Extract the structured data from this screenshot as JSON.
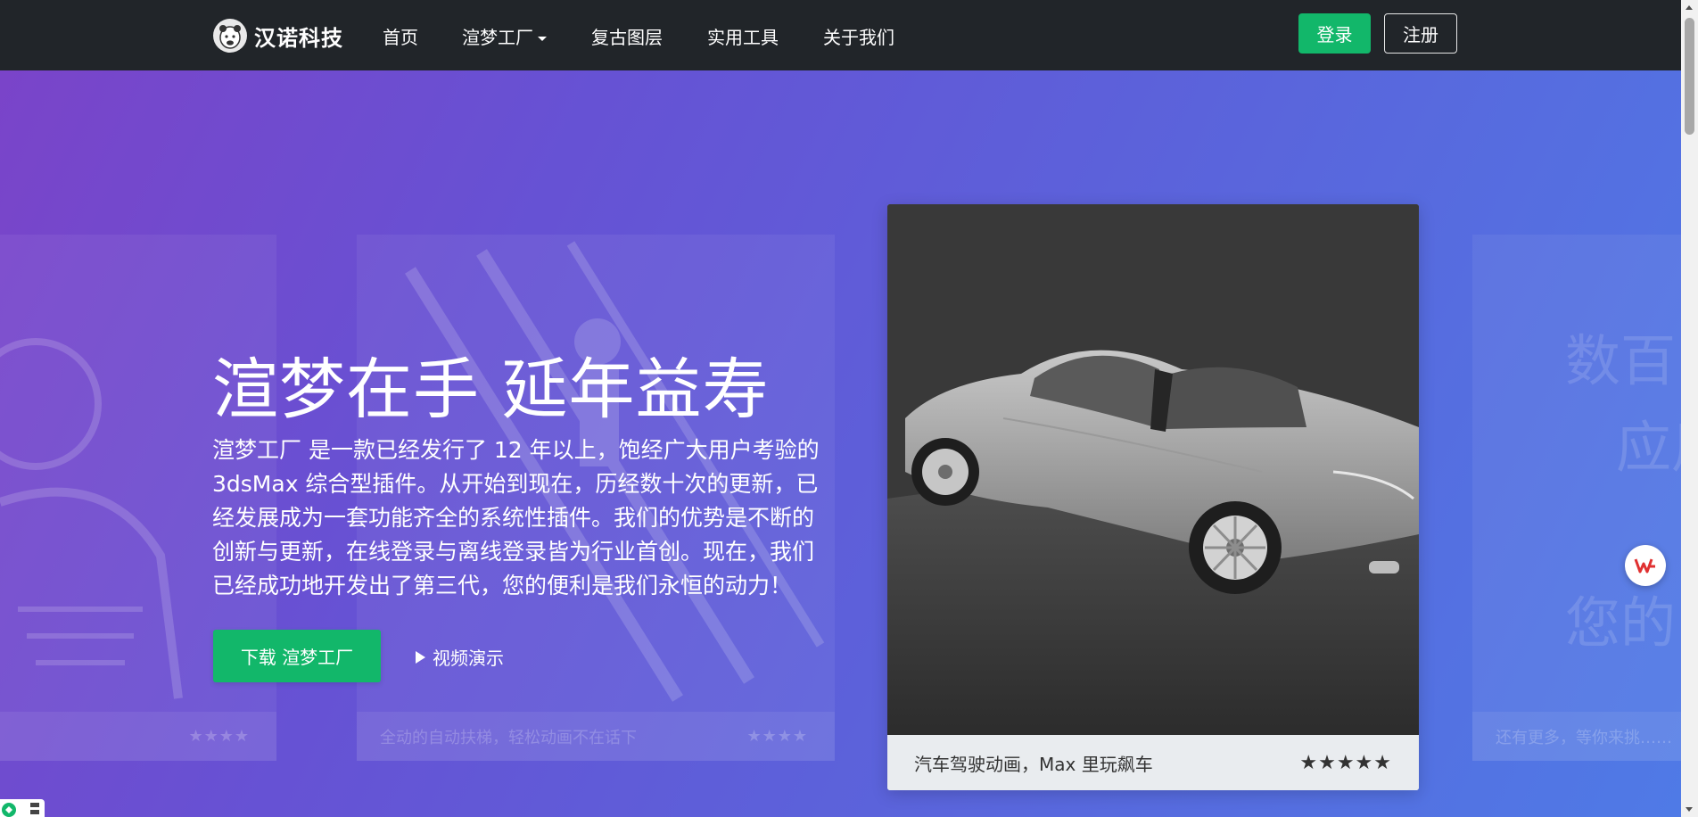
{
  "navbar": {
    "brand_name": "汉诺科技",
    "links": [
      {
        "label": "首页"
      },
      {
        "label": "渲梦工厂"
      },
      {
        "label": "复古图层"
      },
      {
        "label": "实用工具"
      },
      {
        "label": "关于我们"
      }
    ],
    "login_label": "登录",
    "register_label": "注册"
  },
  "hero": {
    "title": "渲梦在手 延年益寿",
    "description": "渲梦工厂 是一款已经发行了 12 年以上，饱经广大用户考验的 3dsMax 综合型插件。从开始到现在，历经数十次的更新，已经发展成为一套功能齐全的系统性插件。我们的优势是不断的创新与更新，在线登录与离线登录皆为行业首创。现在，我们已经成功地开发出了第三代，您的便利是我们永恒的动力！",
    "download_label": "下载 渲梦工厂",
    "video_label": "视频演示"
  },
  "showcase": {
    "caption": "汽车驾驶动画，Max 里玩飙车",
    "rating": "★★★★★"
  },
  "background_cards": {
    "left_stars": "★★★★",
    "middle_caption": "全动的自动扶梯，轻松动画不在话下",
    "middle_stars": "★★★★",
    "right_caption": "还有更多，等你来挑……",
    "right_text_1": "数百",
    "right_text_2": "应用",
    "right_text_3": "您的"
  },
  "colors": {
    "navbar_bg": "#212529",
    "accent_green": "#12b76a",
    "hero_gradient_start": "#7a44c9",
    "hero_gradient_end": "#4f7ae6"
  }
}
